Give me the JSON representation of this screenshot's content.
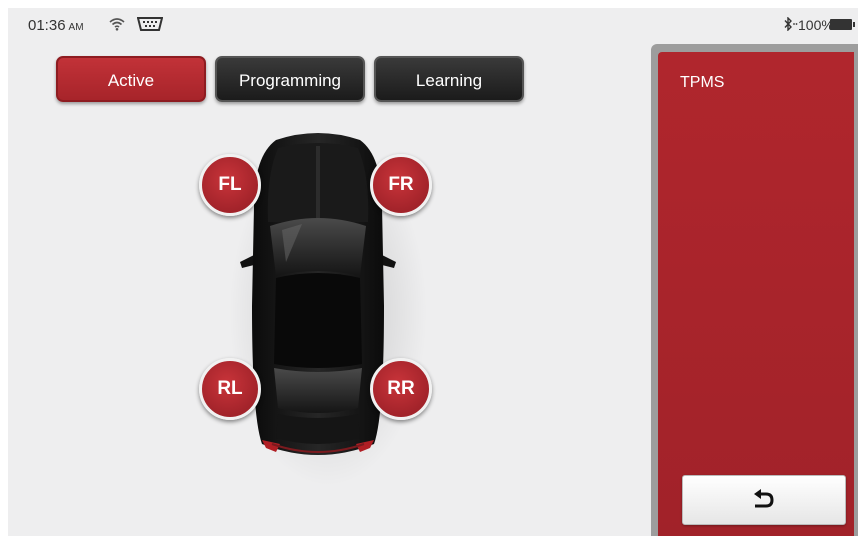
{
  "status_bar": {
    "time": "01:36",
    "ampm": "AM",
    "wifi_icon": "wifi-icon",
    "vci_icon": "vci-connector-icon",
    "bluetooth_icon": "bluetooth-icon",
    "battery_text": "100%",
    "battery_icon": "battery-full-icon"
  },
  "tabs": [
    {
      "label": "Active",
      "selected": true
    },
    {
      "label": "Programming",
      "selected": false
    },
    {
      "label": "Learning",
      "selected": false
    }
  ],
  "tires": {
    "fl": "FL",
    "fr": "FR",
    "rl": "RL",
    "rr": "RR"
  },
  "panel": {
    "title": "TPMS",
    "back_icon": "back-arrow-icon"
  },
  "colors": {
    "accent_red": "#a7242a",
    "tab_dark": "#222222",
    "background": "#eeeeef"
  }
}
